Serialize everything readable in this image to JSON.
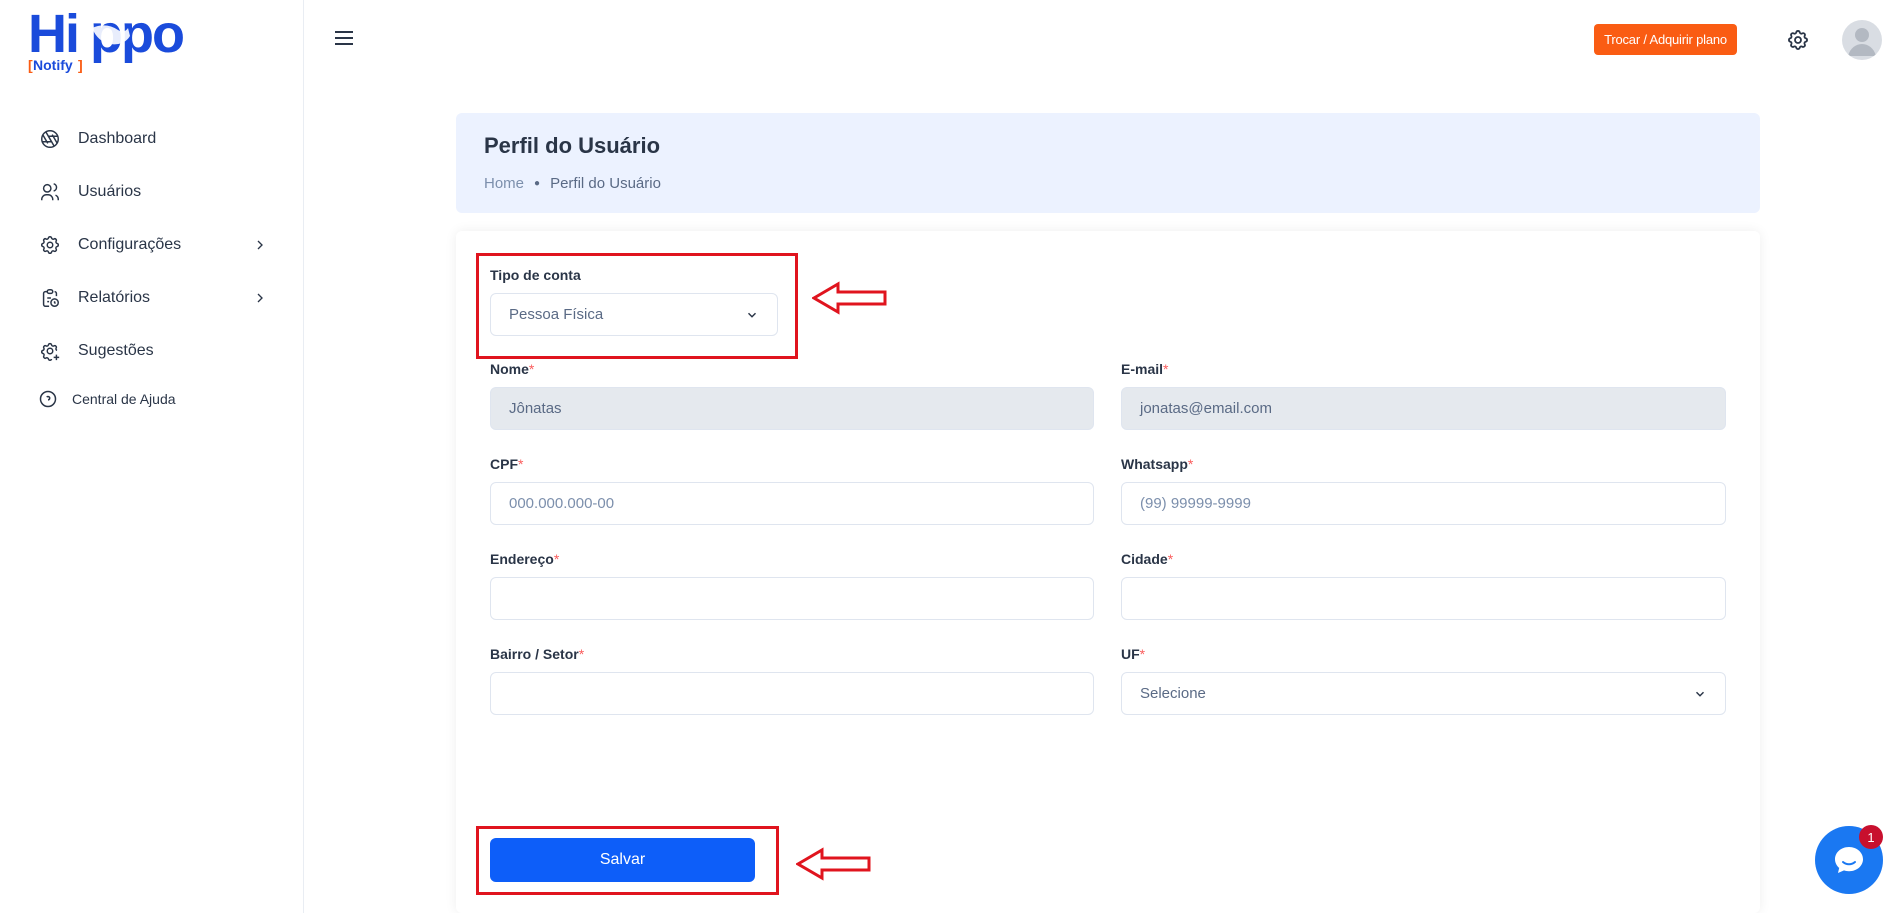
{
  "brand": {
    "name": "Hippo",
    "sub": "[Notify]",
    "color": "#1a4bdb",
    "sub_color": "#1a4bdb"
  },
  "sidebar": {
    "items": [
      {
        "label": "Dashboard",
        "icon": "aperture-icon",
        "has_children": false
      },
      {
        "label": "Usuários",
        "icon": "users-icon",
        "has_children": false
      },
      {
        "label": "Configurações",
        "icon": "gear-icon",
        "has_children": true
      },
      {
        "label": "Relatórios",
        "icon": "clipboard-clock-icon",
        "has_children": true
      },
      {
        "label": "Sugestões",
        "icon": "gear-plus-icon",
        "has_children": false
      },
      {
        "label": "Central de Ajuda",
        "icon": "help-circle-icon",
        "has_children": false
      }
    ]
  },
  "topbar": {
    "plan_button": "Trocar / Adquirir plano",
    "plan_color": "#fa5c13"
  },
  "header": {
    "title": "Perfil do Usuário",
    "breadcrumb": {
      "home": "Home",
      "current": "Perfil do Usuário"
    }
  },
  "form": {
    "account_type": {
      "label": "Tipo de conta",
      "value": "Pessoa Física"
    },
    "name": {
      "label": "Nome",
      "value": "Jônatas"
    },
    "email": {
      "label": "E-mail",
      "value": "jonatas@email.com"
    },
    "cpf": {
      "label": "CPF",
      "placeholder": "000.000.000-00"
    },
    "whatsapp": {
      "label": "Whatsapp",
      "placeholder": "(99) 99999-9999"
    },
    "address": {
      "label": "Endereço",
      "value": ""
    },
    "city": {
      "label": "Cidade",
      "value": ""
    },
    "neighborhood": {
      "label": "Bairro / Setor",
      "value": ""
    },
    "uf": {
      "label": "UF",
      "value": "Selecione"
    },
    "required_mark": "*",
    "save_label": "Salvar"
  },
  "chat": {
    "badge": "1"
  },
  "colors": {
    "primary": "#0d5ef9",
    "annotation": "#e0141e",
    "crumb_bg": "#ecf2ff"
  }
}
